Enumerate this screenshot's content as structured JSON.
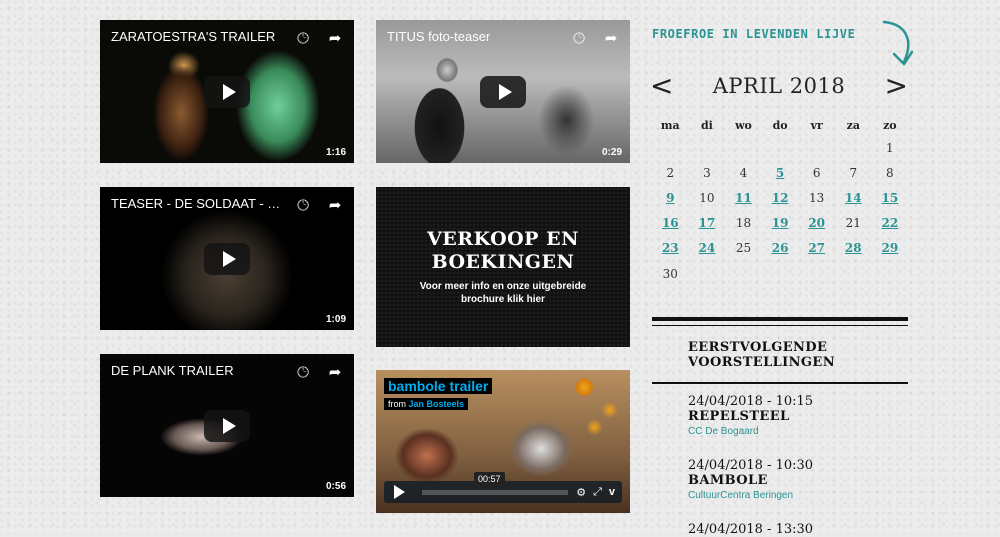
{
  "videos": [
    {
      "title": "ZARATOESTRA'S TRAILER",
      "duration": "1:16"
    },
    {
      "title": "TITUS foto-teaser",
      "duration": "0:29"
    },
    {
      "title": "TEASER - DE SOLDAAT - FROE...",
      "duration": "1:09"
    },
    {
      "title": "DE PLANK TRAILER",
      "duration": "0:56"
    }
  ],
  "promo": {
    "heading_line1": "VERKOOP EN",
    "heading_line2": "BOEKINGEN",
    "text_line1": "Voor meer info en onze uitgebreide",
    "text_line2": "brochure klik hier"
  },
  "vimeo": {
    "title": "bambole trailer",
    "from_label": "from",
    "author": "Jan Bosteels",
    "time": "00:57"
  },
  "sidebar": {
    "title": "FROEFROE IN LEVENDEN LIJVE"
  },
  "calendar": {
    "prev": "<",
    "next": ">",
    "month": "APRIL 2018",
    "weekdays": [
      "ma",
      "di",
      "wo",
      "do",
      "vr",
      "za",
      "zo"
    ],
    "weeks": [
      [
        "",
        "",
        "",
        "",
        "",
        "",
        "1"
      ],
      [
        "2",
        "3",
        "4",
        "5",
        "6",
        "7",
        "8"
      ],
      [
        "9",
        "10",
        "11",
        "12",
        "13",
        "14",
        "15"
      ],
      [
        "16",
        "17",
        "18",
        "19",
        "20",
        "21",
        "22"
      ],
      [
        "23",
        "24",
        "25",
        "26",
        "27",
        "28",
        "29"
      ],
      [
        "30",
        "",
        "",
        "",
        "",
        "",
        ""
      ]
    ],
    "event_days": [
      "5",
      "9",
      "11",
      "12",
      "14",
      "15",
      "16",
      "17",
      "19",
      "20",
      "22",
      "23",
      "24",
      "26",
      "27",
      "28",
      "29"
    ]
  },
  "upcoming": {
    "title_line1": "EERSTVOLGENDE",
    "title_line2": "VOORSTELLINGEN",
    "items": [
      {
        "datetime": "24/04/2018 - 10:15",
        "name": "REPELSTEEL",
        "venue": "CC De Bogaard"
      },
      {
        "datetime": "24/04/2018 - 10:30",
        "name": "BAMBOLE",
        "venue": "CultuurCentra Beringen"
      },
      {
        "datetime": "24/04/2018 - 13:30",
        "name": "",
        "venue": ""
      }
    ]
  },
  "colors": {
    "accent": "#2a9393",
    "vimeo_blue": "#00adef"
  }
}
